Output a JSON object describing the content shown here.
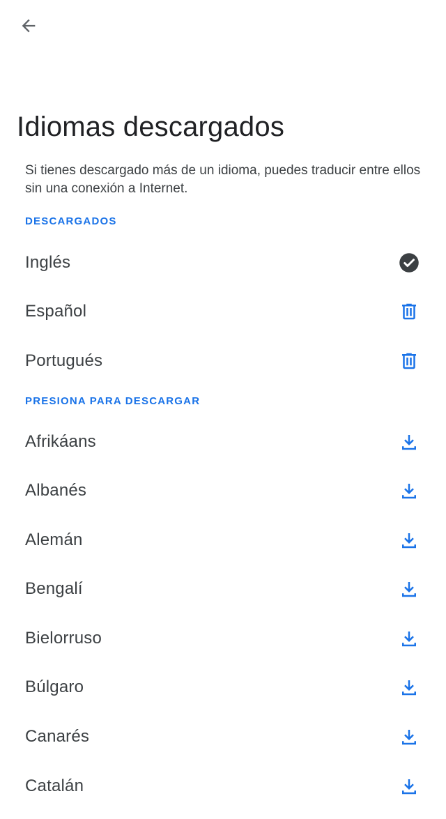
{
  "header": {
    "back_icon": "arrow-back-icon",
    "title": "Idiomas descargados",
    "description": "Si tienes descargado más de un idioma, puedes traducir entre ellos sin una conexión a Internet."
  },
  "colors": {
    "accent": "#1a73e8",
    "check_bg": "#3c4043",
    "text": "#3c4043"
  },
  "downloaded": {
    "header": "DESCARGADOS",
    "items": [
      {
        "label": "Inglés",
        "icon": "check-circle-icon"
      },
      {
        "label": "Español",
        "icon": "trash-icon"
      },
      {
        "label": "Portugués",
        "icon": "trash-icon"
      }
    ]
  },
  "available": {
    "header": "PRESIONA PARA DESCARGAR",
    "items": [
      {
        "label": "Afrikáans",
        "icon": "download-icon"
      },
      {
        "label": "Albanés",
        "icon": "download-icon"
      },
      {
        "label": "Alemán",
        "icon": "download-icon"
      },
      {
        "label": "Bengalí",
        "icon": "download-icon"
      },
      {
        "label": "Bielorruso",
        "icon": "download-icon"
      },
      {
        "label": "Búlgaro",
        "icon": "download-icon"
      },
      {
        "label": "Canarés",
        "icon": "download-icon"
      },
      {
        "label": "Catalán",
        "icon": "download-icon"
      }
    ]
  }
}
